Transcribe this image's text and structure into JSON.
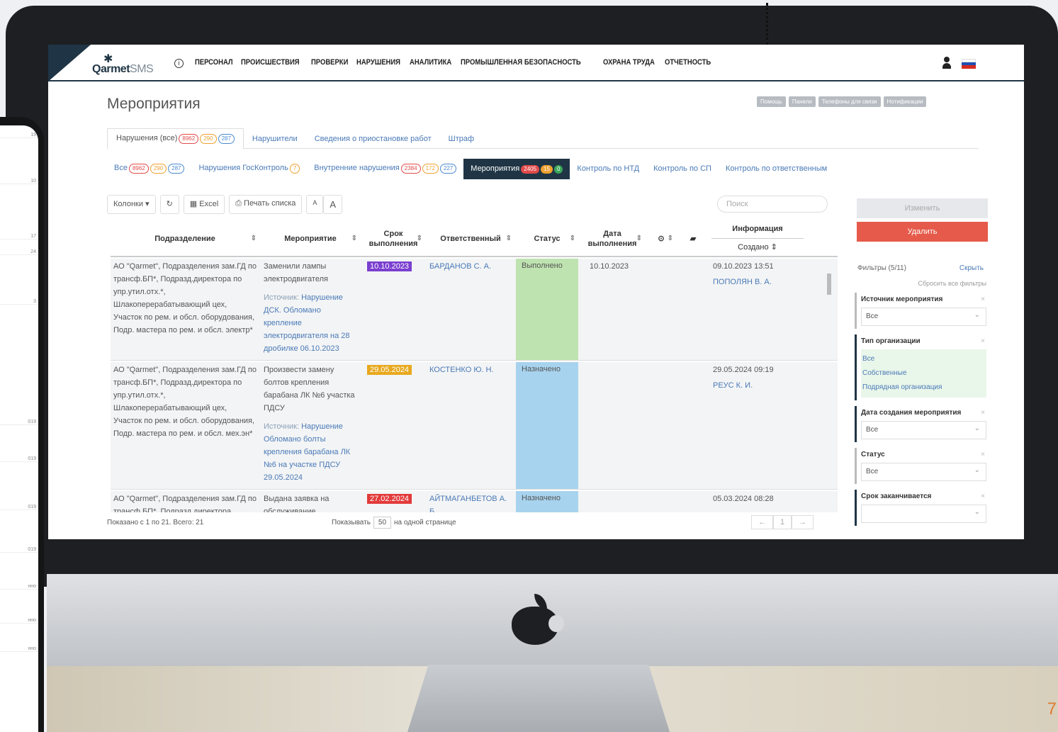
{
  "app": {
    "logo_main": "Qarmet",
    "logo_sms": "SMS"
  },
  "nav": {
    "items": [
      "ПЕРСОНАЛ",
      "ПРОИСШЕСТВИЯ",
      "ПРОВЕРКИ",
      "НАРУШЕНИЯ",
      "АНАЛИТИКА",
      "ПРОМЫШЛЕННАЯ БЕЗОПАСНОСТЬ",
      "ОХРАНА ТРУДА",
      "ОТЧЕТНОСТЬ"
    ]
  },
  "page": {
    "title": "Мероприятия",
    "top_buttons": [
      "Помощь",
      "Панели",
      "Телефоны для связи",
      "Нотификации"
    ]
  },
  "tabs_top": [
    {
      "label": "Нарушения (все)",
      "badges": [
        "8962",
        "290",
        "287"
      ],
      "active": true
    },
    {
      "label": "Нарушители",
      "badges": []
    },
    {
      "label": "Сведения о приостановке работ",
      "badges": []
    },
    {
      "label": "Штраф",
      "badges": []
    }
  ],
  "tabs_sub": [
    {
      "label": "Все",
      "badges": [
        "8962",
        "290",
        "287"
      ]
    },
    {
      "label": "Нарушения ГосКонтроль",
      "badges": [
        "7"
      ]
    },
    {
      "label": "Внутренние нарушения",
      "badges": [
        "2384",
        "172",
        "227"
      ]
    },
    {
      "label": "Мероприятия",
      "badges": [
        "2405",
        "15",
        "0"
      ],
      "active": true
    },
    {
      "label": "Контроль по НТД",
      "badges": []
    },
    {
      "label": "Контроль по СП",
      "badges": []
    },
    {
      "label": "Контроль по ответственным",
      "badges": []
    }
  ],
  "toolbar": {
    "columns": "Колонки",
    "excel": "Excel",
    "print": "Печать списка",
    "font_small": "A",
    "font_large": "A",
    "search_placeholder": "Поиск"
  },
  "actions": {
    "change": "Изменить",
    "delete": "Удалить"
  },
  "table": {
    "headers": {
      "division": "Подразделение",
      "measure": "Мероприятие",
      "deadline": "Срок выполнения",
      "responsible": "Ответственный",
      "status": "Статус",
      "done_date": "Дата выполнения",
      "info": "Информация",
      "created": "Создано"
    },
    "source_label": "Источник:",
    "rows": [
      {
        "division": "АО \"Qarmet\", Подразделения зам.ГД по трансф.БП*, Подразд.директора по упр.утил.отх.*, Шлакоперерабатывающий цех, Участок по рем. и обсл. оборудования, Подр. мастера по рем. и обсл. электр*",
        "measure": "Заменили лампы электродвигателя",
        "source": "Нарушение ДСК. Обломано крепление электродвигателя на 28 дробилке 06.10.2023",
        "deadline": "10.10.2023",
        "deadline_color": "#7a3fd0",
        "responsible": "БАРДАНОВ С. А.",
        "status": "Выполнено",
        "status_color": "#bfe3b0",
        "done_date": "10.10.2023",
        "created": "09.10.2023 13:51",
        "created_by": "ПОПОЛЯН В. А."
      },
      {
        "division": "АО \"Qarmet\", Подразделения зам.ГД по трансф.БП*, Подразд.директора по упр.утил.отх.*, Шлакоперерабатывающий цех, Участок по рем. и обсл. оборудования, Подр. мастера по рем. и обсл. мех.эн*",
        "measure": "Произвести замену болтов крепления барабана ЛК №6 участка ПДСУ",
        "source": "Нарушение Обломано болты крепления барабана ЛК №6 на участке ПДСУ 29.05.2024",
        "deadline": "29.05.2024",
        "deadline_color": "#e8a81e",
        "responsible": "КОСТЕНКО Ю. Н.",
        "status": "Назначено",
        "status_color": "#a8d3ee",
        "done_date": "",
        "created": "29.05.2024 09:19",
        "created_by": "РЕУС К. И."
      },
      {
        "division": "АО \"Qarmet\", Подразделения зам.ГД по трансф.БП*, Подразд.директора",
        "measure": "Выдана заявка на обслуживание",
        "source": "",
        "deadline": "27.02.2024",
        "deadline_color": "#e23a3a",
        "responsible": "АЙТМАГАНБЕТОВ А. Б.",
        "status": "Назначено",
        "status_color": "#a8d3ee",
        "done_date": "",
        "created": "05.03.2024 08:28",
        "created_by": ""
      }
    ]
  },
  "footer": {
    "shown": "Показано с 1 по 21. Всего: 21",
    "show_label": "Показывать",
    "per_page": "50",
    "per_page_suffix": "на одной странице",
    "prev": "←",
    "page": "1",
    "next": "→"
  },
  "filters": {
    "header": "Фильтры (5/11)",
    "hide": "Скрыть",
    "reset": "Сбросить все фильтры",
    "groups": [
      {
        "title": "Источник мероприятия",
        "value": "Все",
        "type": "select"
      },
      {
        "title": "Тип организации",
        "options": [
          "Все",
          "Собственные",
          "Подрядная организация"
        ],
        "type": "list"
      },
      {
        "title": "Дата создания мероприятия",
        "value": "Все",
        "type": "select"
      },
      {
        "title": "Статус",
        "value": "Все",
        "type": "select"
      },
      {
        "title": "Срок заканчивается",
        "value": "",
        "type": "select"
      }
    ]
  },
  "colors": {
    "brand": "#1f3545",
    "delete": "#e55a4a"
  },
  "phone": {
    "rows": [
      "19",
      "10",
      "17",
      "24",
      "3",
      "019",
      "019",
      "019",
      "019",
      "нно",
      "нно",
      "нно"
    ]
  },
  "page_number": "7"
}
